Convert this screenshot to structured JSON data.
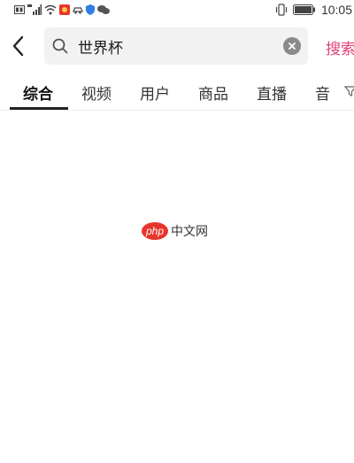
{
  "status_bar": {
    "time": "10:05",
    "icons": [
      "hd-icon",
      "signal-4g-icon",
      "wifi-icon",
      "app-notification-icon",
      "car-icon",
      "security-shield-icon",
      "wechat-icon",
      "vibrate-icon",
      "battery-icon"
    ]
  },
  "header": {
    "back_icon": "chevron-left-icon",
    "search_icon": "search-icon",
    "search_value": "世界杯",
    "clear_icon": "clear-icon",
    "search_button_label": "搜索"
  },
  "tabs": {
    "items": [
      "综合",
      "视频",
      "用户",
      "商品",
      "直播",
      "音"
    ],
    "active_index": 0,
    "filter_icon": "filter-icon"
  },
  "watermark": {
    "logo_text": "php",
    "text": "中文网"
  },
  "colors": {
    "accent": "#e0407a",
    "search_bg": "#f2f2f2",
    "logo_red": "#e8352b"
  }
}
